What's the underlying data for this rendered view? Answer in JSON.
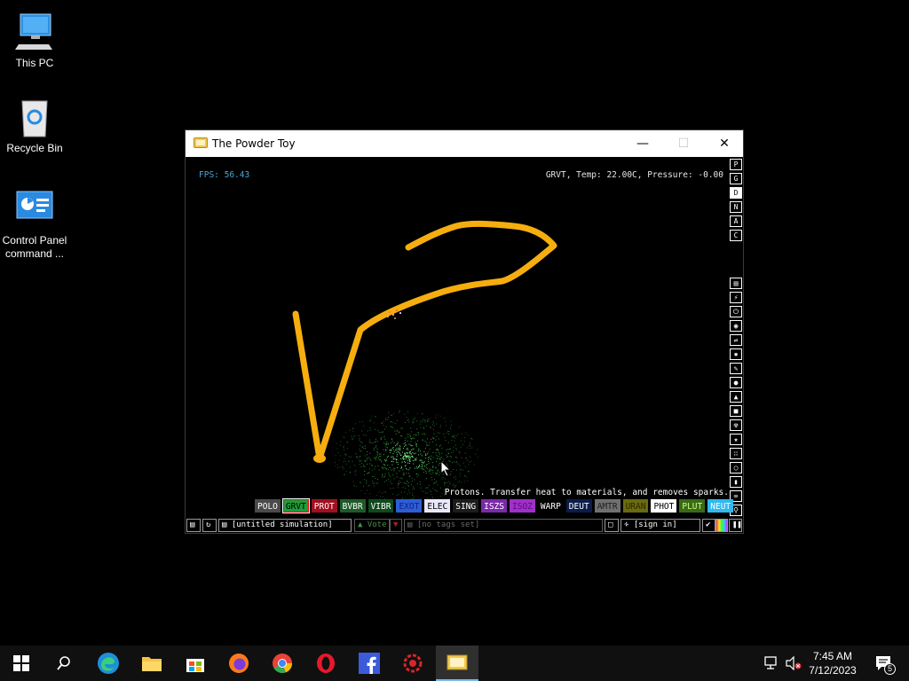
{
  "desktop": {
    "icons": [
      {
        "label": "This PC"
      },
      {
        "label": "Recycle Bin"
      },
      {
        "label": "Control Panel command ..."
      }
    ]
  },
  "window": {
    "title": "The Powder Toy"
  },
  "simulation": {
    "fps": "FPS: 56.43",
    "status": "GRVT, Temp: 22.00C, Pressure: -0.00",
    "description": "Protons. Transfer heat to materials, and removes sparks."
  },
  "right_menu": {
    "top_buttons": [
      "P",
      "G",
      "D",
      "N",
      "A",
      "C"
    ],
    "active": "D"
  },
  "elements": [
    {
      "label": "POLO",
      "bg": "#4a4a4a",
      "fg": "#ffffff"
    },
    {
      "label": "GRVT",
      "bg": "#1f9c3a",
      "fg": "#000000",
      "selected": true
    },
    {
      "label": "PROT",
      "bg": "#a01020",
      "fg": "#ffffff"
    },
    {
      "label": "BVBR",
      "bg": "#1e5a28",
      "fg": "#ffffff"
    },
    {
      "label": "VIBR",
      "bg": "#0e4a1c",
      "fg": "#ffffff"
    },
    {
      "label": "EXOT",
      "bg": "#2a5fd6",
      "fg": "#1a1a8a"
    },
    {
      "label": "ELEC",
      "bg": "#e8e8f8",
      "fg": "#000000"
    },
    {
      "label": "SING",
      "bg": "#1c1c1c",
      "fg": "#ffffff"
    },
    {
      "label": "ISZS",
      "bg": "#7a2aa8",
      "fg": "#ffffff"
    },
    {
      "label": "ISOZ",
      "bg": "#a030c8",
      "fg": "#5a0a80"
    },
    {
      "label": "WARP",
      "bg": "#000000",
      "fg": "#ffffff"
    },
    {
      "label": "DEUT",
      "bg": "#0c1c4a",
      "fg": "#ffffff"
    },
    {
      "label": "AMTR",
      "bg": "#707070",
      "fg": "#202020"
    },
    {
      "label": "URAN",
      "bg": "#6a6a10",
      "fg": "#2a2a00"
    },
    {
      "label": "PHOT",
      "bg": "#ffffff",
      "fg": "#000000"
    },
    {
      "label": "PLUT",
      "bg": "#3a6a18",
      "fg": "#c8ff80"
    },
    {
      "label": "NEUT",
      "bg": "#30b8f0",
      "fg": "#ffffff"
    }
  ],
  "bottom_bar": {
    "save_name": "[untitled simulation]",
    "vote": "Vote",
    "tags": "[no tags set]",
    "sign_in": "[sign in]"
  },
  "taskbar": {
    "time": "7:45 AM",
    "date": "7/12/2023",
    "notification_count": "5"
  },
  "colors": {
    "stroke": "#f5ae0e",
    "grav_particles": "#3dd84a",
    "fps_text": "#4aa8d8"
  }
}
